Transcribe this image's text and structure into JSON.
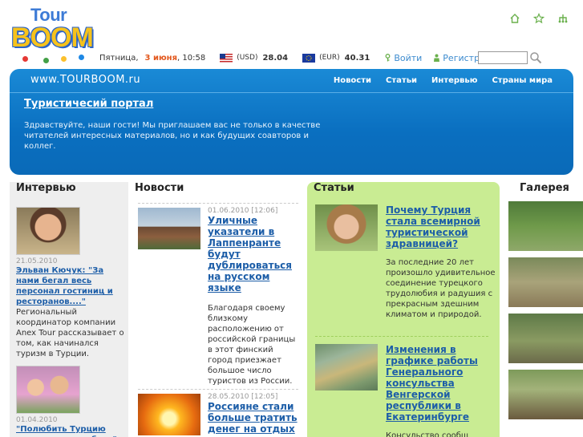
{
  "logo": {
    "line1": "Tour",
    "line2": "BOOM"
  },
  "top_icons": [
    "home-icon",
    "star-icon",
    "sitemap-icon"
  ],
  "infobar": {
    "day": "Пятница,",
    "date": "3 июня",
    "time": ", 10:58",
    "usd_label": "(USD)",
    "usd_rate": "28.04",
    "eur_label": "(EUR)",
    "eur_rate": "40.31",
    "login": "Войти",
    "register": "Регистрация"
  },
  "search": {
    "placeholder": ""
  },
  "banner": {
    "site_url": "www.TOURBOOM.ru",
    "nav": [
      "Новости",
      "Статьи",
      "Интервью",
      "Страны мира"
    ],
    "title": "Туристичесий портал",
    "text": "Здравствуйте, наши гости! Мы приглашаем вас не только в качестве читателей интересных материалов, но и как будущих соавторов и коллег."
  },
  "interview": {
    "heading": "Интервью",
    "items": [
      {
        "date": "21.05.2010",
        "title": "Эльван Кючук: \"За нами бегал весь персонал гостиниц и ресторанов....\"",
        "text": "Региональный координатор компании Anex Tour рассказывает о том, как начинался туризм в Турции."
      },
      {
        "date": "01.04.2010",
        "title": "\"Полюбить Турцию мне помогла любовь\"",
        "text": ""
      }
    ]
  },
  "news": {
    "heading": "Новости",
    "items": [
      {
        "date": "01.06.2010 [12:06]",
        "title": "Уличные указатели в Лаппенранте будут дублироваться на русском языке",
        "text": "Благодаря своему близкому расположению от российской границы в этот финский город приезжает большое число туристов из России."
      },
      {
        "date": "28.05.2010 [12:05]",
        "title": "Россияне стали больше тратить денег на отдых",
        "text": ""
      }
    ]
  },
  "articles": {
    "heading": "Статьи",
    "items": [
      {
        "title": "Почему Турция стала всемирной туристической здравницей?",
        "text": "За последние 20 лет произошло удивительное соединение турецкого трудолюбия и радушия с прекрасным здешним климатом и природой."
      },
      {
        "title": "Изменения в графике работы Генерального консульства Венгерской республики в Екатеринбурге",
        "text": "Консульство сообщ"
      }
    ]
  },
  "gallery": {
    "heading": "Галерея"
  },
  "colors": {
    "accent": "#0a6fc0",
    "articles_bg": "#c9ec93",
    "link": "#1d5ea8",
    "date_highlight": "#e2571c"
  }
}
